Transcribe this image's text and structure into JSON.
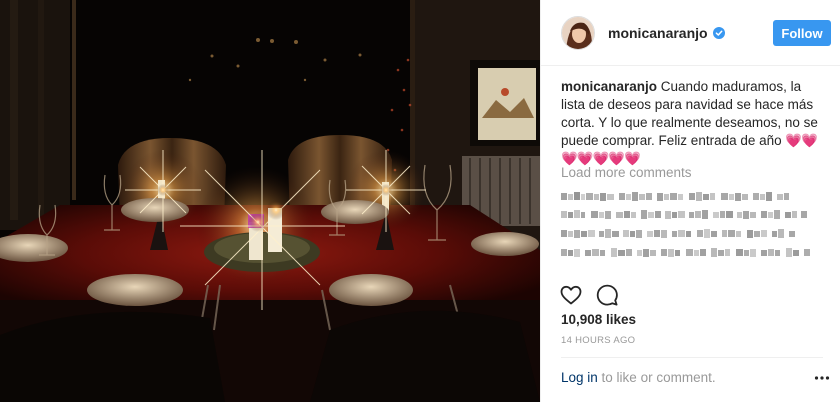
{
  "post": {
    "username": "monicanaranjo",
    "follow_label": "Follow",
    "caption_username": "monicanaranjo",
    "caption_text": "Cuando maduramos, la lista de deseos para navidad se hace más corta. Y lo que realmente deseamos, no se puede comprar. Feliz entrada de año",
    "caption_hearts_1": "💗💗",
    "caption_hearts_2": "💗💗💗💗💗",
    "load_more": "Load more comments",
    "likes": "10,908 likes",
    "timestamp": "14 HOURS AGO",
    "login_link": "Log in",
    "login_rest": " to like or comment."
  },
  "icons": {
    "verified": "verified-badge-icon",
    "like": "heart-outline-icon",
    "comment": "speech-bubble-icon",
    "options": "ellipsis-icon"
  },
  "colors": {
    "follow_button": "#3897f0",
    "verified": "#3897f0",
    "text": "#262626",
    "muted": "#999999",
    "link": "#003569"
  }
}
